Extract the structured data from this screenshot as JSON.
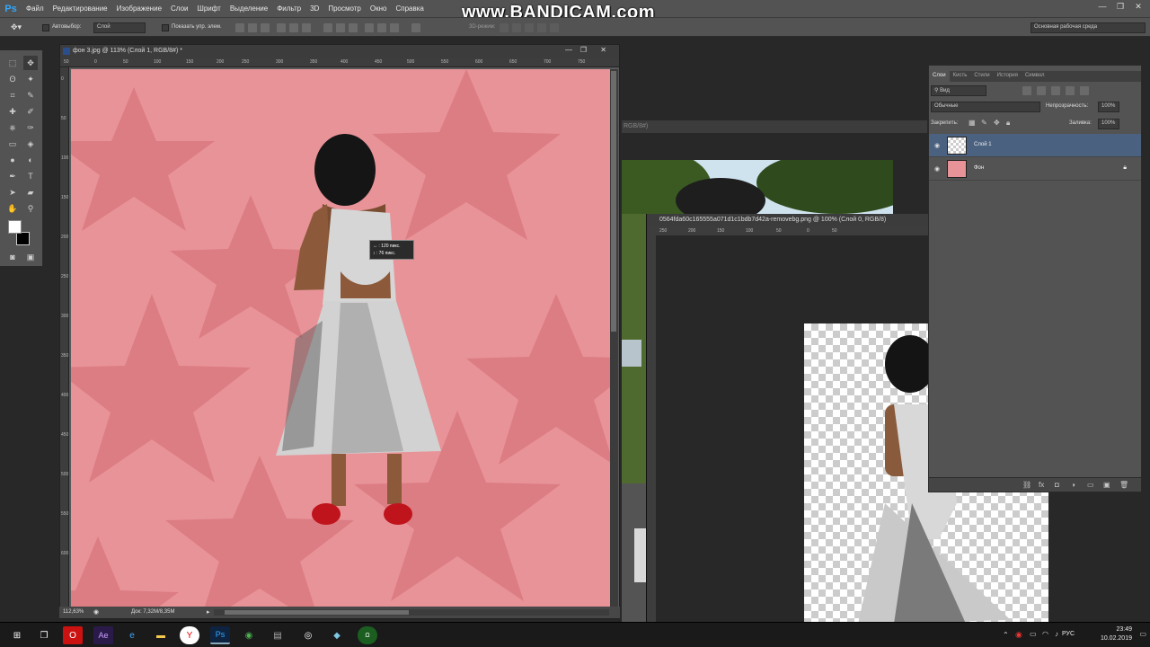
{
  "app": {
    "logo": "Ps",
    "menu": [
      "Файл",
      "Редактирование",
      "Изображение",
      "Слои",
      "Шрифт",
      "Выделение",
      "Фильтр",
      "3D",
      "Просмотр",
      "Окно",
      "Справка"
    ],
    "watermark": "www.BANDICAM.com"
  },
  "options_bar": {
    "autoselect_label": "Автовыбор:",
    "autoselect_value": "Слой",
    "show_controls_label": "Показать упр. элем.",
    "mode_3d_label": "3D-режим:",
    "workspace": "Основная рабочая среда"
  },
  "document": {
    "tab_title": "фон 3.jpg @ 113% (Слой 1, RGB/8#) *",
    "ruler_top": [
      "50",
      "0",
      "50",
      "100",
      "150",
      "200",
      "250",
      "300",
      "350",
      "400",
      "450",
      "500",
      "550",
      "600",
      "650",
      "700",
      "750"
    ],
    "ruler_left": [
      "0",
      "50",
      "100",
      "150",
      "200",
      "250",
      "300",
      "350",
      "400",
      "450",
      "500",
      "550",
      "600"
    ],
    "zoom": "112,63%",
    "doc_size": "Док: 7,32M/8,35M",
    "move_tooltip": {
      "dx": "120 пикс.",
      "dy": "76 пикс."
    }
  },
  "doc2": {
    "tab_title": "RGB/8#)"
  },
  "doc3": {
    "tab_title": "0564fda60c165555a071d1c1bdb7d42a-removebg.png @ 100% (Слой 0, RGB/8)",
    "ruler": [
      "250",
      "200",
      "150",
      "100",
      "50",
      "0",
      "50"
    ]
  },
  "layers_panel": {
    "tabs": [
      "Слои",
      "Кисть",
      "Стили",
      "История",
      "Символ"
    ],
    "filter": "Вид",
    "blend_mode": "Обычные",
    "opacity_label": "Непрозрачность:",
    "opacity_value": "100%",
    "lock_label": "Закрепить:",
    "fill_label": "Заливка:",
    "fill_value": "100%",
    "layers": [
      {
        "name": "Слой 1",
        "selected": true
      },
      {
        "name": "Фон",
        "selected": false,
        "locked": true
      }
    ]
  },
  "taskbar": {
    "lang": "РУС",
    "time": "23:49",
    "date": "10.02.2019"
  }
}
